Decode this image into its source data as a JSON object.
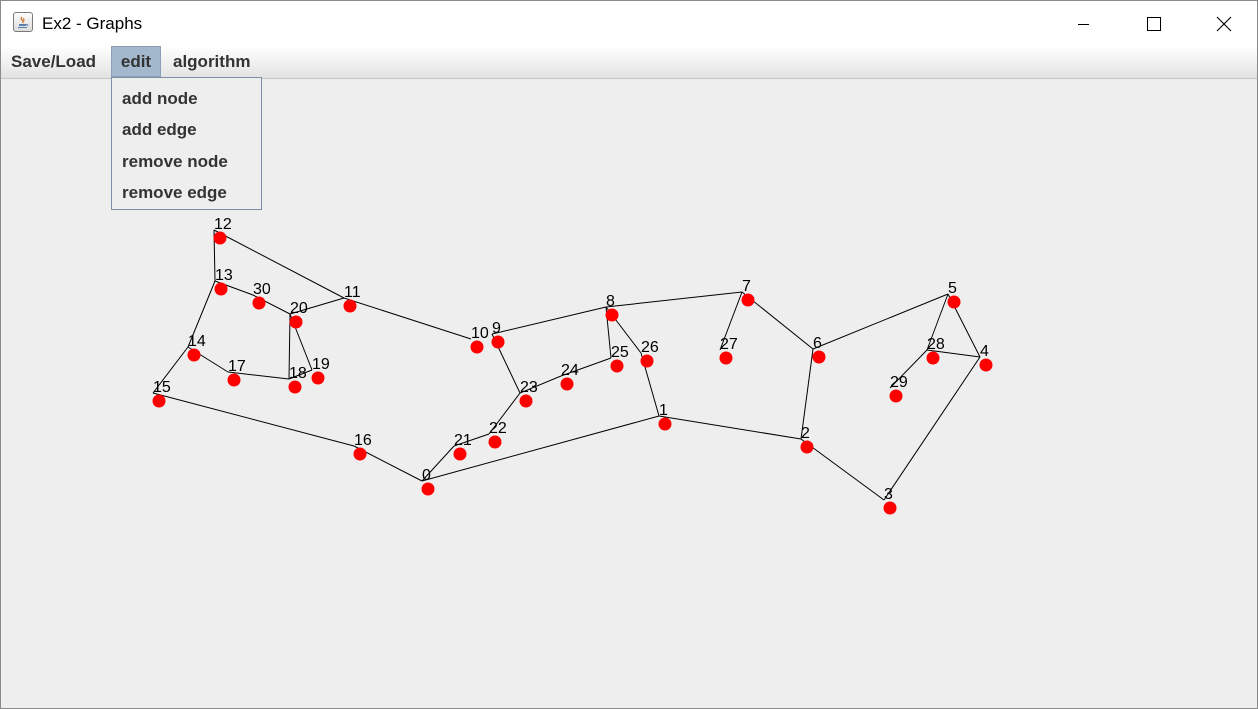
{
  "window": {
    "title": "Ex2 - Graphs"
  },
  "menubar": {
    "items": [
      {
        "label": "Save/Load"
      },
      {
        "label": "edit"
      },
      {
        "label": "algorithm"
      }
    ]
  },
  "edit_menu": {
    "items": [
      {
        "label": "add node"
      },
      {
        "label": "add edge"
      },
      {
        "label": "remove node"
      },
      {
        "label": "remove edge"
      }
    ]
  },
  "graph": {
    "node_color": "#ff0000",
    "edge_color": "#000000",
    "nodes": [
      "0",
      "1",
      "2",
      "3",
      "4",
      "5",
      "6",
      "7",
      "8",
      "9",
      "10",
      "11",
      "12",
      "13",
      "14",
      "15",
      "16",
      "17",
      "18",
      "19",
      "20",
      "21",
      "22",
      "23",
      "24",
      "25",
      "26",
      "27",
      "28",
      "29",
      "30"
    ],
    "edges": [
      [
        "0",
        "1"
      ],
      [
        "0",
        "16"
      ],
      [
        "0",
        "21"
      ],
      [
        "1",
        "2"
      ],
      [
        "1",
        "26"
      ],
      [
        "2",
        "3"
      ],
      [
        "2",
        "6"
      ],
      [
        "3",
        "4"
      ],
      [
        "4",
        "5"
      ],
      [
        "4",
        "28"
      ],
      [
        "5",
        "6"
      ],
      [
        "5",
        "28"
      ],
      [
        "6",
        "7"
      ],
      [
        "7",
        "8"
      ],
      [
        "7",
        "27"
      ],
      [
        "8",
        "9"
      ],
      [
        "8",
        "25"
      ],
      [
        "8",
        "26"
      ],
      [
        "9",
        "23"
      ],
      [
        "10",
        "11"
      ],
      [
        "11",
        "12"
      ],
      [
        "11",
        "20"
      ],
      [
        "12",
        "13"
      ],
      [
        "13",
        "14"
      ],
      [
        "13",
        "30"
      ],
      [
        "14",
        "15"
      ],
      [
        "14",
        "17"
      ],
      [
        "15",
        "16"
      ],
      [
        "17",
        "18"
      ],
      [
        "18",
        "19"
      ],
      [
        "18",
        "20"
      ],
      [
        "19",
        "20"
      ],
      [
        "20",
        "30"
      ],
      [
        "21",
        "22"
      ],
      [
        "22",
        "23"
      ],
      [
        "23",
        "24"
      ],
      [
        "24",
        "25"
      ],
      [
        "28",
        "29"
      ]
    ]
  }
}
